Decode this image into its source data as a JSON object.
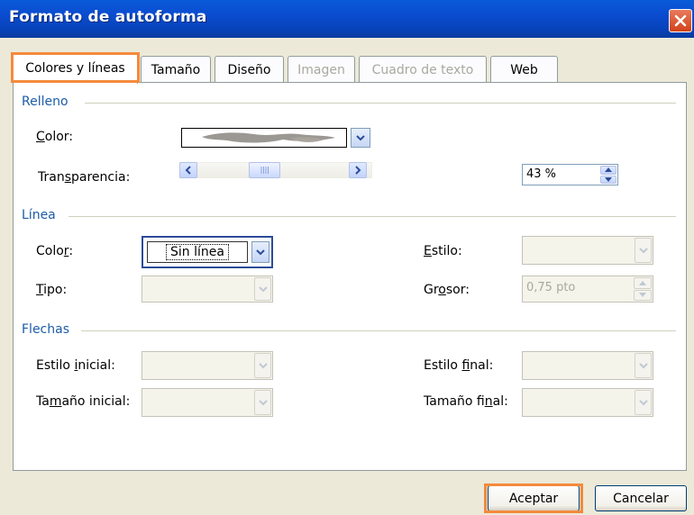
{
  "window": {
    "title": "Formato de autoforma"
  },
  "tabs": [
    {
      "label": "Colores y líneas",
      "state": "active"
    },
    {
      "label": "Tamaño",
      "state": "enabled"
    },
    {
      "label": "Diseño",
      "state": "enabled"
    },
    {
      "label": "Imagen",
      "state": "disabled"
    },
    {
      "label": "Cuadro de texto",
      "state": "disabled"
    },
    {
      "label": "Web",
      "state": "enabled"
    }
  ],
  "relleno": {
    "title": "Relleno",
    "color_label": "Color:",
    "transparency_label": "Transparencia:",
    "transparency_value": "43 %",
    "transparency_fraction": 0.43
  },
  "linea": {
    "title": "Línea",
    "color_label": "Color:",
    "color_value": "Sin línea",
    "tipo_label": "Tipo:",
    "estilo_label": "Estilo:",
    "grosor_label": "Grosor:",
    "grosor_value": "0,75 pto"
  },
  "flechas": {
    "title": "Flechas",
    "estilo_inicial_label": "Estilo inicial:",
    "tamano_inicial_label": "Tamaño inicial:",
    "estilo_final_label": "Estilo final:",
    "tamano_final_label": "Tamaño final:"
  },
  "buttons": {
    "ok": "Aceptar",
    "cancel": "Cancelar"
  },
  "colors": {
    "titlebar": "#0a4bd0",
    "section_title": "#1c5ca8",
    "highlight": "#f48a3c",
    "dialog_bg": "#ece9d8"
  }
}
